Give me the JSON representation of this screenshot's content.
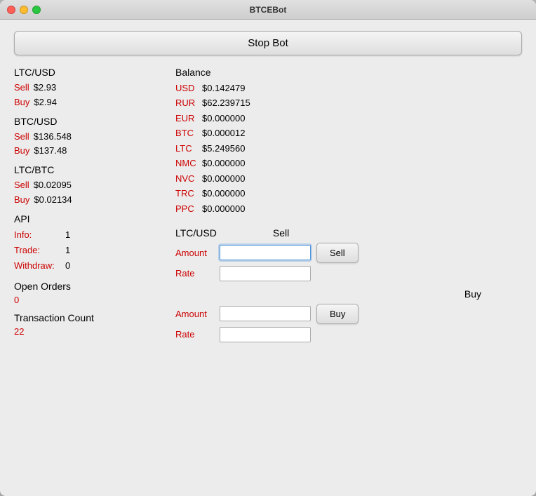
{
  "window": {
    "title": "BTCEBot"
  },
  "buttons": {
    "stop_bot": "Stop Bot",
    "sell": "Sell",
    "buy": "Buy"
  },
  "left_panel": {
    "ltc_usd": {
      "label": "LTC/USD",
      "sell_label": "Sell",
      "sell_value": "$2.93",
      "buy_label": "Buy",
      "buy_value": "$2.94"
    },
    "btc_usd": {
      "label": "BTC/USD",
      "sell_label": "Sell",
      "sell_value": "$136.548",
      "buy_label": "Buy",
      "buy_value": "$137.48"
    },
    "ltc_btc": {
      "label": "LTC/BTC",
      "sell_label": "Sell",
      "sell_value": "$0.02095",
      "buy_label": "Buy",
      "buy_value": "$0.02134"
    },
    "api": {
      "label": "API",
      "info_label": "Info:",
      "info_value": "1",
      "trade_label": "Trade:",
      "trade_value": "1",
      "withdraw_label": "Withdraw:",
      "withdraw_value": "0"
    },
    "open_orders": {
      "label": "Open Orders",
      "value": "0"
    },
    "transaction_count": {
      "label": "Transaction Count",
      "value": "22"
    }
  },
  "right_panel": {
    "balance": {
      "label": "Balance",
      "rows": [
        {
          "currency": "USD",
          "amount": "$0.142479"
        },
        {
          "currency": "RUR",
          "amount": "$62.239715"
        },
        {
          "currency": "EUR",
          "amount": "$0.000000"
        },
        {
          "currency": "BTC",
          "amount": "$0.000012"
        },
        {
          "currency": "LTC",
          "amount": "$5.249560"
        },
        {
          "currency": "NMC",
          "amount": "$0.000000"
        },
        {
          "currency": "NVC",
          "amount": "$0.000000"
        },
        {
          "currency": "TRC",
          "amount": "$0.000000"
        },
        {
          "currency": "PPC",
          "amount": "$0.000000"
        }
      ]
    },
    "trade": {
      "pair": "LTC/USD",
      "sell_label": "Sell",
      "buy_label": "Buy",
      "amount_label": "Amount",
      "rate_label": "Rate"
    }
  }
}
